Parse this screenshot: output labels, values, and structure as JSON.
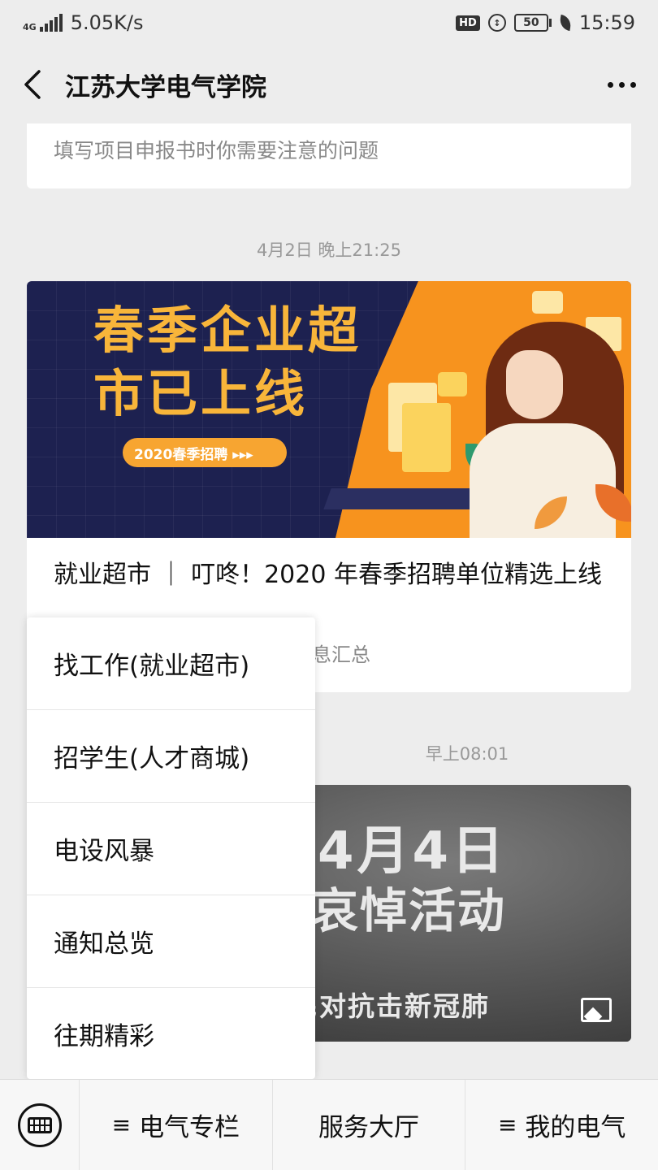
{
  "status_bar": {
    "network_type": "4G",
    "speed": "5.05K/s",
    "hd": "HD",
    "battery": "50",
    "time": "15:59"
  },
  "nav": {
    "title": "江苏大学电气学院",
    "back_icon": "chevron-left-icon",
    "more_icon": "more-dots-icon"
  },
  "feed": {
    "prev_article_digest": "填写项目申报书时你需要注意的问题",
    "timestamp_1": "4月2日 晚上21:25",
    "article": {
      "banner_headline": "春季企业超市已上线",
      "banner_tag": "2020春季招聘 ▸▸▸",
      "title": "就业超市 ｜ 叮咚！2020 年春季招聘单位精选上线",
      "subtitle": "息汇总"
    },
    "timestamp_2": "早上08:01",
    "second_article": {
      "line1": "年4月4日",
      "line2": "性哀悼活动",
      "line3": "人民对抗击新冠肺"
    }
  },
  "popup_menu": {
    "items": [
      "找工作(就业超市)",
      "招学生(人才商城)",
      "电设风暴",
      "通知总览",
      "往期精彩"
    ]
  },
  "bottom_menu": {
    "keyboard_icon": "keyboard-icon",
    "tabs": [
      {
        "prefix": "≡",
        "label": "电气专栏"
      },
      {
        "prefix": "",
        "label": "服务大厅"
      },
      {
        "prefix": "≡",
        "label": "我的电气"
      }
    ]
  },
  "colors": {
    "banner_bg": "#1d2150",
    "banner_orange": "#f7931e",
    "banner_text": "#f8b53a",
    "page_bg": "#ededed"
  }
}
